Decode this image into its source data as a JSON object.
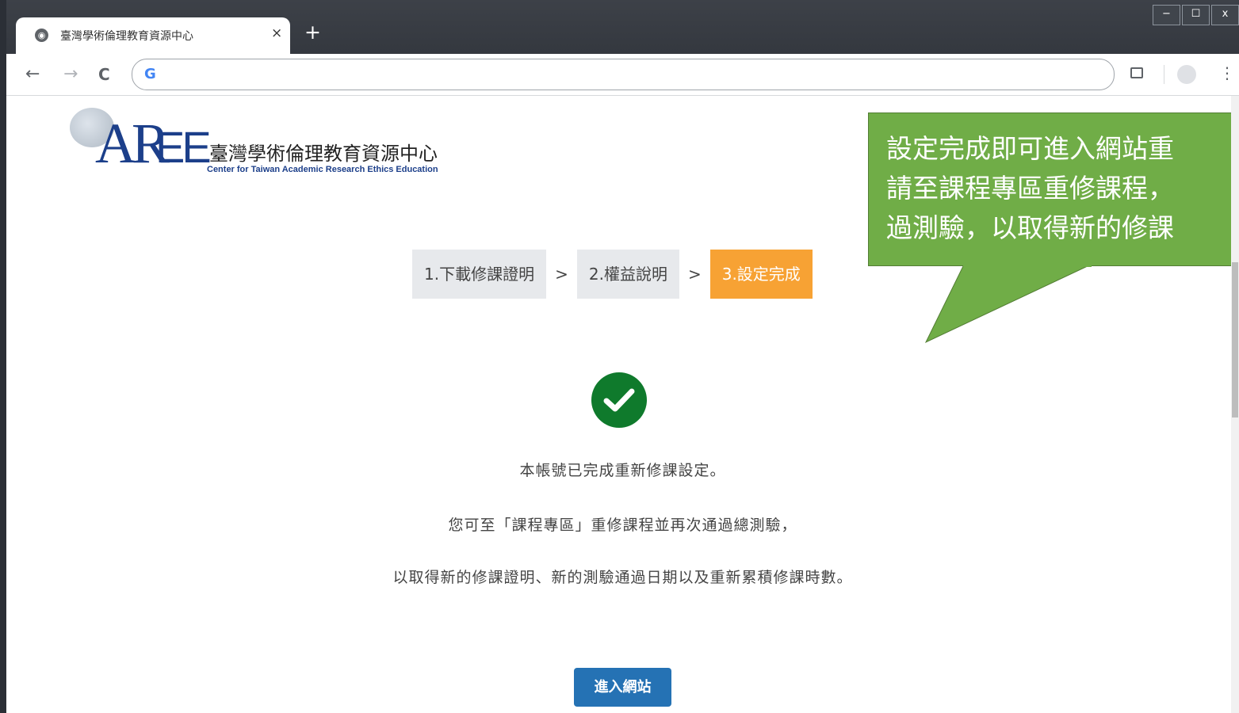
{
  "browser": {
    "tab_title": "臺灣學術倫理教育資源中心",
    "tab_close": "×",
    "new_tab": "+",
    "window_buttons": [
      "−",
      "☐",
      "x"
    ],
    "nav_back": "←",
    "nav_forward": "→",
    "nav_reload": "C",
    "address_value": "",
    "menu_glyph": "⋮"
  },
  "logo": {
    "mark": "AR",
    "mark_ee": "EE",
    "name_cn": "臺灣學術倫理教育資源中心",
    "name_en": "Center for Taiwan Academic Research Ethics Education"
  },
  "steps": {
    "items": [
      "1.下載修課證明",
      "2.權益說明",
      "3.設定完成"
    ],
    "separator": ">",
    "active_index": 2,
    "active_color": "#f7a234"
  },
  "status": {
    "icon": "check-circle-icon",
    "color": "#0f7a2c"
  },
  "messages": {
    "line1": "本帳號已完成重新修課設定。",
    "line2": "您可至「課程專區」重修課程並再次通過總測驗，",
    "line3": "以取得新的修課證明、新的測驗通過日期以及重新累積修課時數。"
  },
  "enter_button": "進入網站",
  "callout": {
    "line1": "設定完成即可進入網站重",
    "line2": "請至課程專區重修課程，",
    "line3": "過測驗，以取得新的修課",
    "color": "#70ad47"
  }
}
